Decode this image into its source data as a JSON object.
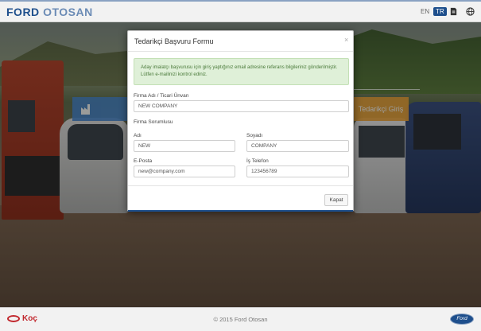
{
  "header": {
    "brand_primary": "FORD",
    "brand_secondary": "OTOSAN",
    "languages": [
      "EN",
      "TR"
    ],
    "active_language": "TR",
    "icons": [
      "document-icon",
      "globe-icon"
    ]
  },
  "background": {
    "supplier_login_tile": "Tedarikçi Giriş"
  },
  "modal": {
    "title": "Tedarikçi Başvuru Formu",
    "close_symbol": "×",
    "alert_message": "Aday imalatçı başvurusu için giriş yaptığınız email adresine referans bilgileriniz gönderilmiştir. Lütfen e-mailinizi kontrol ediniz.",
    "fields": {
      "company_label": "Firma Adı / Ticari Ünvan",
      "company_value": "NEW COMPANY",
      "responsible_section": "Firma Sorumlusu",
      "first_name_label": "Adı",
      "first_name_value": "NEW",
      "last_name_label": "Soyadı",
      "last_name_value": "COMPANY",
      "email_label": "E-Posta",
      "email_value": "new@company.com",
      "phone_label": "İş Telefon",
      "phone_value": "123456789"
    },
    "close_button": "Kapat"
  },
  "footer": {
    "koc_logo_text": "Koç",
    "copyright": "© 2015 Ford Otosan",
    "ford_logo_text": "Ford"
  },
  "colors": {
    "brand_blue": "#1e4f8c",
    "alert_bg": "#dff0d8",
    "tile_orange": "#e8a33c",
    "tile_blue": "#4a86c8"
  }
}
